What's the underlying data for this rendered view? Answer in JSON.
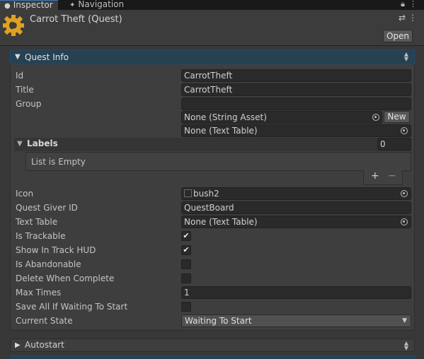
{
  "tabs": [
    {
      "label": "Inspector",
      "icon": "info-icon"
    },
    {
      "label": "Navigation",
      "icon": "navigation-icon"
    }
  ],
  "header": {
    "title": "Carrot Theft (Quest)",
    "open_label": "Open"
  },
  "quest_info": {
    "label": "Quest Info",
    "fields": {
      "id": {
        "label": "Id",
        "value": "CarrotTheft"
      },
      "title": {
        "label": "Title",
        "value": "CarrotTheft"
      },
      "group": {
        "label": "Group",
        "value": "",
        "asset": "None (String Asset)",
        "table": "None (Text Table)",
        "new_label": "New"
      },
      "labels": {
        "label": "Labels",
        "count": "0",
        "empty_text": "List is Empty",
        "add": "+",
        "remove": "−"
      },
      "icon": {
        "label": "Icon",
        "value": "bush2"
      },
      "quest_giver_id": {
        "label": "Quest Giver ID",
        "value": "QuestBoard"
      },
      "text_table": {
        "label": "Text Table",
        "value": "None (Text Table)"
      },
      "is_trackable": {
        "label": "Is Trackable",
        "checked": true
      },
      "show_in_track_hud": {
        "label": "Show In Track HUD",
        "checked": true
      },
      "is_abandonable": {
        "label": "Is Abandonable",
        "checked": false
      },
      "delete_when_complete": {
        "label": "Delete When Complete",
        "checked": false
      },
      "max_times": {
        "label": "Max Times",
        "value": "1"
      },
      "save_all_if_waiting": {
        "label": "Save All If Waiting To Start",
        "checked": false
      },
      "current_state": {
        "label": "Current State",
        "value": "Waiting To Start"
      }
    }
  },
  "autostart": {
    "label": "Autostart"
  },
  "check_mark": "✔",
  "colors": {
    "accent": "#264152",
    "background": "#383838",
    "field": "#2a2a2a"
  }
}
